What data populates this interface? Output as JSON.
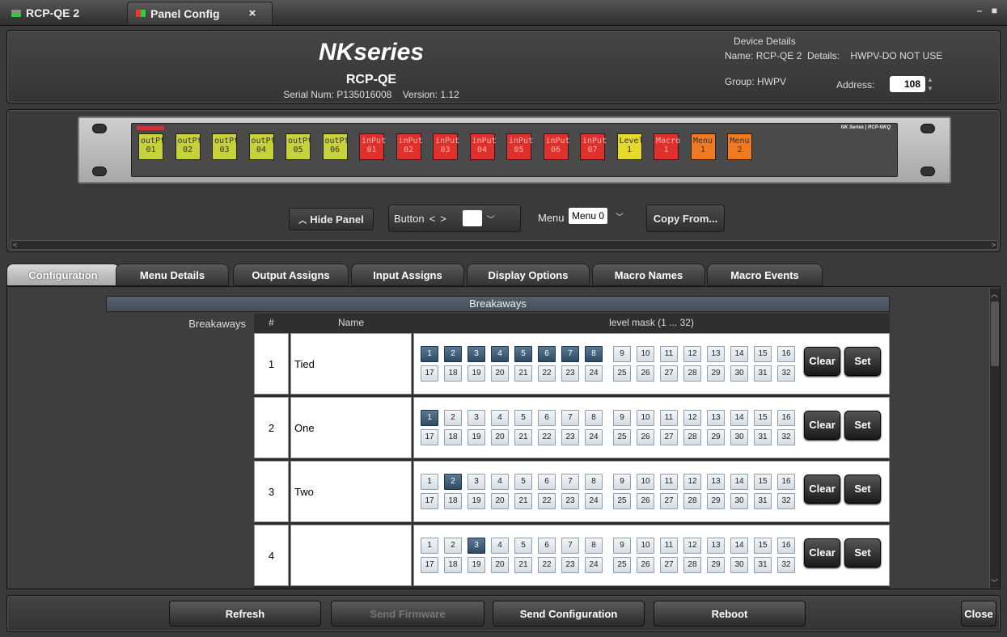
{
  "window": {
    "tabs": [
      {
        "label": "RCP-QE 2",
        "icon": "device-status-icon",
        "active": false
      },
      {
        "label": "Panel Config",
        "icon": "panel-config-icon",
        "active": true
      }
    ],
    "close_tab": "×",
    "controls": "– ■"
  },
  "header": {
    "brand": "NKseries",
    "model": "RCP-QE",
    "serial_label": "Serial Num:",
    "serial": "P135016008",
    "version_label": "Version:",
    "version": "1.12",
    "device_details_title": "Device Details",
    "name_label": "Name:",
    "name": "RCP-QE 2",
    "details_label": "Details:",
    "details": "HWPV-DO NOT USE",
    "group_label": "Group:",
    "group": "HWPV",
    "address_label": "Address:",
    "address": "108"
  },
  "device_panel": {
    "series_label": "NK Series | RCP-NKQ",
    "buttons": [
      {
        "line1": "outPt",
        "line2": "01",
        "color": "#c9d13a"
      },
      {
        "line1": "outPt",
        "line2": "02",
        "color": "#c9d13a"
      },
      {
        "line1": "outPt",
        "line2": "03",
        "color": "#c9d13a"
      },
      {
        "line1": "outPt",
        "line2": "04",
        "color": "#c9d13a"
      },
      {
        "line1": "outPt",
        "line2": "05",
        "color": "#c9d13a"
      },
      {
        "line1": "outPt",
        "line2": "06",
        "color": "#c9d13a"
      },
      {
        "line1": "inPut",
        "line2": "01",
        "color": "#e0302c"
      },
      {
        "line1": "inPut",
        "line2": "02",
        "color": "#e0302c"
      },
      {
        "line1": "inPut",
        "line2": "03",
        "color": "#e0302c"
      },
      {
        "line1": "inPut",
        "line2": "04",
        "color": "#e0302c"
      },
      {
        "line1": "inPut",
        "line2": "05",
        "color": "#e0302c"
      },
      {
        "line1": "inPut",
        "line2": "06",
        "color": "#e0302c"
      },
      {
        "line1": "inPut",
        "line2": "07",
        "color": "#e0302c"
      },
      {
        "line1": "Level",
        "line2": "1",
        "color": "#e6d92c"
      },
      {
        "line1": "Macro",
        "line2": "1",
        "color": "#e0302c"
      },
      {
        "line1": "Menu",
        "line2": "1",
        "color": "#f07a22"
      },
      {
        "line1": "Menu",
        "line2": "2",
        "color": "#f07a22"
      }
    ]
  },
  "panel_controls": {
    "hide_panel": "Hide Panel",
    "button_label": "Button",
    "prev": "<",
    "next": ">",
    "menu_label": "Menu",
    "menu_value": "Menu 0",
    "copy_from": "Copy From..."
  },
  "tabs": [
    "Configuration",
    "Menu Details",
    "Output Assigns",
    "Input Assigns",
    "Display Options",
    "Macro Names",
    "Macro Events"
  ],
  "active_tab": "Configuration",
  "breakaways": {
    "section_title": "Breakaways",
    "row_label": "Breakaways",
    "col_num": "#",
    "col_name": "Name",
    "col_mask": "level mask (1 ... 32)",
    "clear_label": "Clear",
    "set_label": "Set",
    "rows": [
      {
        "num": "1",
        "name": "Tied",
        "on": [
          1,
          2,
          3,
          4,
          5,
          6,
          7,
          8
        ]
      },
      {
        "num": "2",
        "name": "One",
        "on": [
          1
        ]
      },
      {
        "num": "3",
        "name": "Two",
        "on": [
          2
        ]
      },
      {
        "num": "4",
        "name": "",
        "on": [
          3
        ]
      }
    ]
  },
  "footer": {
    "refresh": "Refresh",
    "send_firmware": "Send Firmware",
    "send_configuration": "Send Configuration",
    "reboot": "Reboot",
    "close": "Close"
  },
  "colors": {
    "mask_on": "#2f4b63",
    "mask_off": "#e4e9ee",
    "background": "#3a3a3a"
  }
}
